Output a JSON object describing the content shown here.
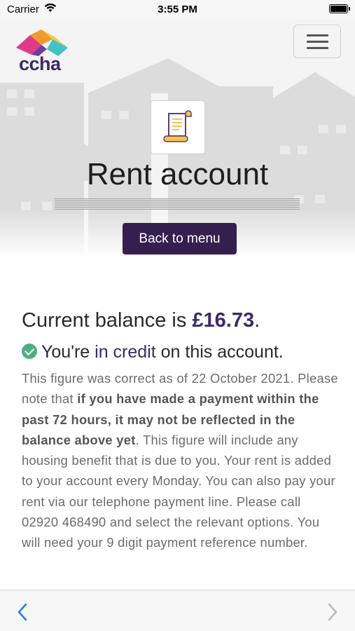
{
  "status_bar": {
    "carrier": "Carrier",
    "time": "3:55 PM"
  },
  "header": {
    "logo_text": "ccha"
  },
  "page": {
    "title": "Rent account",
    "back_button_label": "Back to menu"
  },
  "balance": {
    "prefix": "Current balance is ",
    "amount": "£16.73",
    "suffix": "."
  },
  "credit_status": {
    "prefix": "You're ",
    "highlight": "in credit",
    "suffix": " on this account."
  },
  "info": {
    "line_date": "This figure was correct as of 22 October 2021.",
    "note_prefix": "Please note that ",
    "note_bold": "if you have made a payment within the past 72 hours, it may not be reflected in the balance above yet",
    "note_suffix": ". This figure will include any housing benefit that is due to you. Your rent is added to your account every Monday. You can also pay your rent via our telephone payment line. Please call 02920 468490 and select the relevant options. You will need your 9 digit payment reference number."
  },
  "colors": {
    "brand_purple": "#34204f",
    "accent_purple": "#3b2a6b",
    "success_green": "#4caf82",
    "ios_blue": "#1a7ef5"
  }
}
